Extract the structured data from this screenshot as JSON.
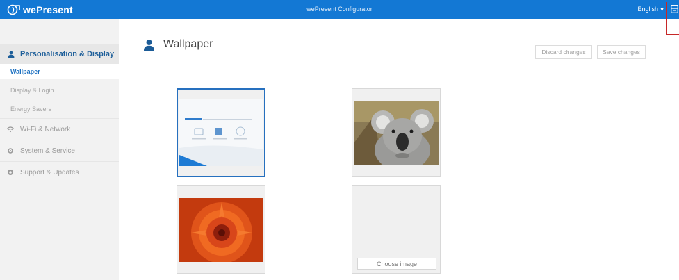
{
  "topbar": {
    "brand": "wePresent",
    "title": "wePresent Configurator",
    "language": "English",
    "color": "#1378d4"
  },
  "sidebar": {
    "section_label": "Personalisation & Display",
    "sub_items": [
      {
        "label": "Wallpaper",
        "active": true
      },
      {
        "label": "Display & Login",
        "active": false
      },
      {
        "label": "Energy Savers",
        "active": false
      }
    ],
    "items": [
      {
        "label": "Wi-Fi & Network",
        "icon": "wifi-icon"
      },
      {
        "label": "System & Service",
        "icon": "gear-icon"
      },
      {
        "label": "Support & Updates",
        "icon": "lifebuoy-icon"
      }
    ]
  },
  "main": {
    "title": "Wallpaper",
    "title_icon": "person-icon",
    "discard_label": "Discard changes",
    "save_label": "Save changes"
  },
  "wallpapers": [
    {
      "name": "default-wepresent",
      "selected": true
    },
    {
      "name": "koala",
      "selected": false
    },
    {
      "name": "red-flower",
      "selected": false
    },
    {
      "name": "custom",
      "selected": false,
      "choose_label": "Choose image"
    }
  ],
  "colors": {
    "accent": "#1378d4",
    "active_text": "#1a6fc0",
    "selected_border": "#2670bf",
    "highlight_box": "#c62828"
  }
}
